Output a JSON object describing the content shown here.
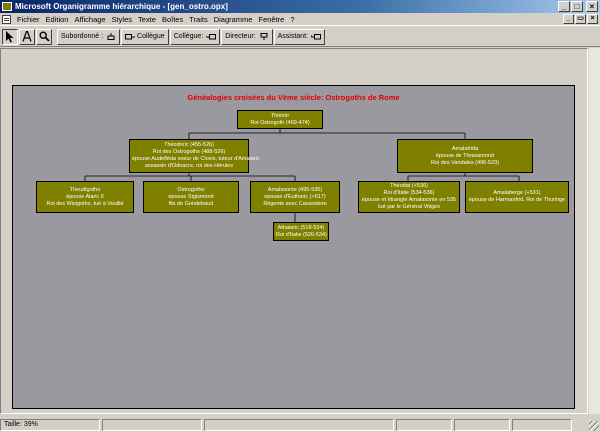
{
  "window": {
    "title": "Microsoft Organigramme hiérarchique - [gen_ostro.opx]",
    "buttons": {
      "minimize": "_",
      "maximize": "□",
      "close": "×"
    }
  },
  "menu": {
    "items": [
      "Fichier",
      "Edition",
      "Affichage",
      "Styles",
      "Texte",
      "Boîtes",
      "Traits",
      "Diagramme",
      "Fenêtre",
      "?"
    ],
    "mdi_buttons": {
      "minimize": "_",
      "restore": "▭",
      "close": "×"
    }
  },
  "toolbar": {
    "pointer_icon": "arrow-pointer-icon",
    "text_icon": "text-tool-icon",
    "zoom_icon": "magnifier-icon",
    "subordinate": "Subordonné :",
    "colleague_left": "Collègue",
    "colleague_right": "Collègue: ",
    "manager": "Directeur:",
    "assistant": "Assistant:"
  },
  "chart": {
    "title": "Généalogies croisées du Vème siècle: Ostrogoths de Rome",
    "colors": {
      "background": "#9a99a0",
      "box": "#808000",
      "title": "#e00000"
    },
    "boxes": {
      "thiemir": [
        "Thiémir",
        "Roi Ostrogoth (469-474)"
      ],
      "theodoric": [
        "Théodoric (455-526)",
        "Roi des Ostrogoths (488-526)",
        "épouse Audefléda soeur de Clovis, tuteur d'Amalaric",
        "assassin d'Odoacre, roi des Hérules"
      ],
      "amalafrida": [
        "Amalafrida",
        "épouse de Thrasamond",
        "Roi des Vandales (496-523)"
      ],
      "theudigotho": [
        "Theudigotho",
        "épouse Alaric II",
        "Roi des Wisigoths, tué à Vouillé"
      ],
      "ostrogotho": [
        "Ostrogotho",
        "épouse Sigismond",
        "fils de Gondebaud"
      ],
      "amalasonte": [
        "Amalasonte (495-535)",
        "épouse d'Eutharic (+517)",
        "Régente avec Cassiodore"
      ],
      "theodat": [
        "Théodat (+536)",
        "Roi d'Italie (534-536)",
        "épouse et étrangle Amalasonte en 535",
        "tué par le Général Vitiges"
      ],
      "amalaberge": [
        "Amalaberge (+531)",
        "épouse de Harmanfrid, Roi de Thuringe"
      ],
      "athalaric": [
        "Athalaric (518-534)",
        "Roi d'Italie (526-534)"
      ]
    }
  },
  "status": {
    "zoom": "Taille: 39%"
  }
}
